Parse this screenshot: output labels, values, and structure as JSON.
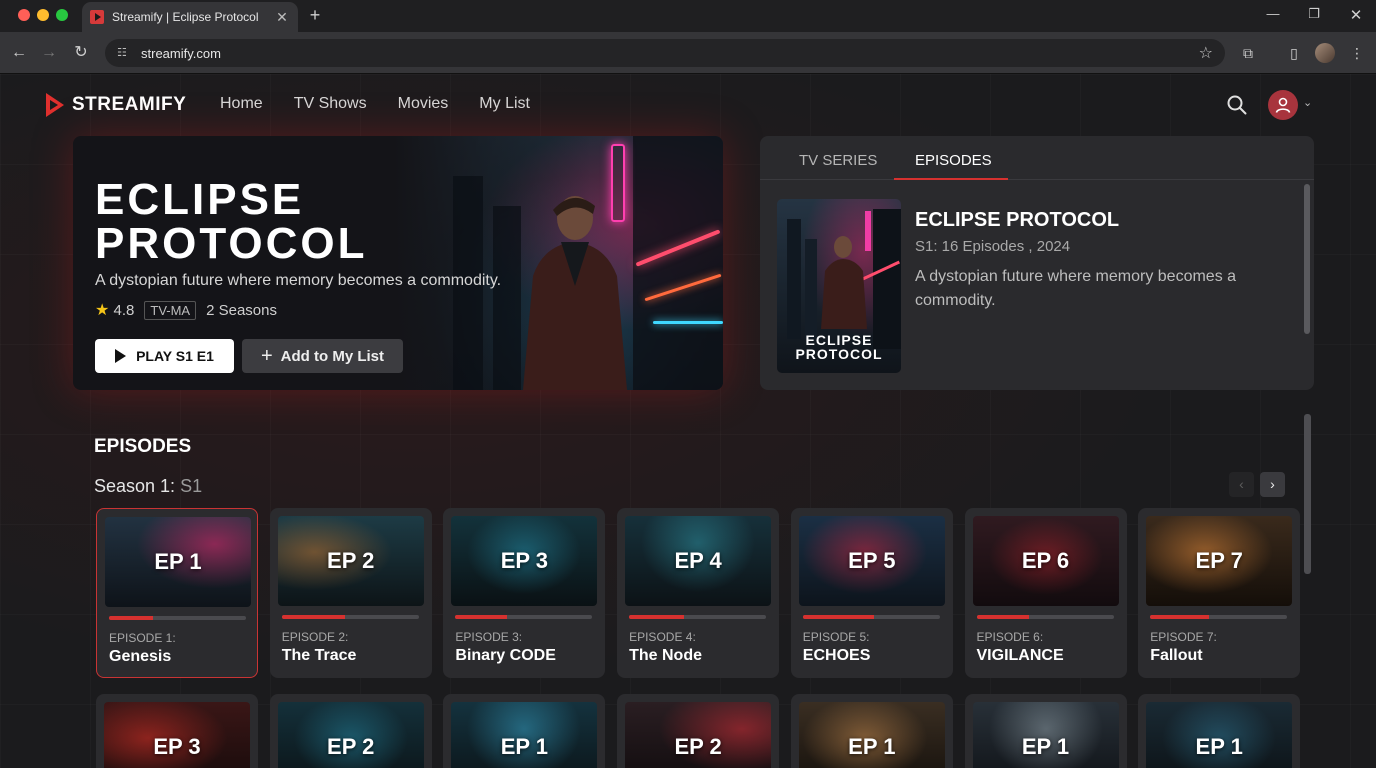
{
  "browser": {
    "tab_title": "Streamify | Eclipse Protocol",
    "url": "streamify.com"
  },
  "site": {
    "logo": "STREAMIFY",
    "nav": [
      "Home",
      "TV Shows",
      "Movies",
      "My List"
    ]
  },
  "hero": {
    "title_line1": "ECLIPSE",
    "title_line2": "PROTOCOL",
    "description": "A dystopian future where memory becomes a commodity.",
    "rating": "4.8",
    "maturity": "TV-MA",
    "seasons": "2 Seasons",
    "play_label": "PLAY S1 E1",
    "add_label": "Add to My List"
  },
  "info_panel": {
    "tabs": [
      "TV SERIES",
      "EPISODES"
    ],
    "active_tab": "EPISODES",
    "poster_line1": "ECLIPSE",
    "poster_line2": "PROTOCOL",
    "title": "ECLIPSE PROTOCOL",
    "subtitle": "S1: 16 Episodes , 2024",
    "description": "A dystopian future where memory becomes a commodity."
  },
  "episodes": {
    "heading": "EPISODES",
    "season_prefix": "Season 1: ",
    "season_value": "S1",
    "row1": [
      {
        "thumb": "EP 1",
        "number": "EPISODE 1:",
        "name": "Genesis",
        "progress": 0.32,
        "active": true
      },
      {
        "thumb": "EP 2",
        "number": "EPISODE 2:",
        "name": "The Trace",
        "progress": 0.46
      },
      {
        "thumb": "EP 3",
        "number": "EPISODE 3:",
        "name": "Binary CODE",
        "progress": 0.38
      },
      {
        "thumb": "EP 4",
        "number": "EPISODE 4:",
        "name": "The Node",
        "progress": 0.4
      },
      {
        "thumb": "EP 5",
        "number": "EPISODE 5:",
        "name": "ECHOES",
        "progress": 0.52
      },
      {
        "thumb": "EP 6",
        "number": "EPISODE 6:",
        "name": "VIGILANCE",
        "progress": 0.38
      },
      {
        "thumb": "EP 7",
        "number": "EPISODE 7:",
        "name": "Fallout",
        "progress": 0.43
      }
    ],
    "row2": [
      "EP 3",
      "EP 2",
      "EP 1",
      "EP 2",
      "EP 1",
      "EP 1",
      "EP 1"
    ]
  },
  "colors": {
    "accent": "#d6312f",
    "background": "#1b1b1d",
    "card": "#2b2b2e"
  }
}
